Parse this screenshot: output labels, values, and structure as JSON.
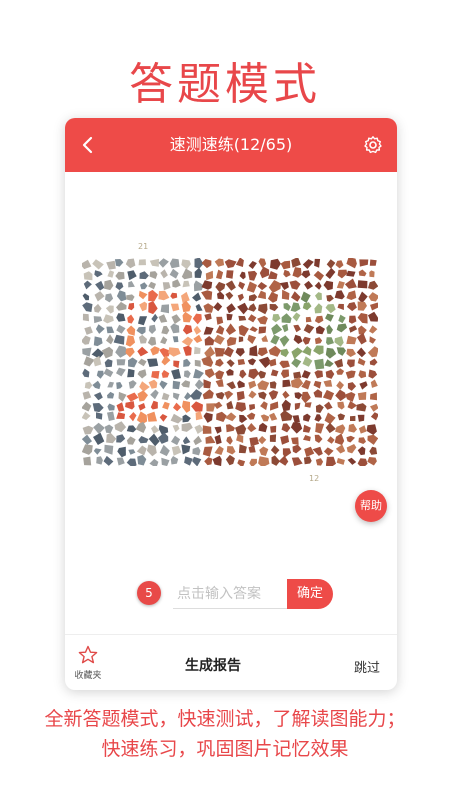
{
  "promo": {
    "title": "答题模式",
    "caption_line1": "全新答题模式，快速测试，了解读图能力；",
    "caption_line2": "快速练习，巩固图片记忆效果"
  },
  "app_bar": {
    "title": "速测速练(12/65)"
  },
  "plate": {
    "label_top": "21",
    "label_bottom": "12"
  },
  "help_button": {
    "label": "帮助"
  },
  "answer": {
    "badge": "5",
    "placeholder": "点击输入答案",
    "value": "",
    "confirm_label": "确定"
  },
  "bottom_bar": {
    "favorites_label": "收藏夹",
    "report_label": "生成报告",
    "skip_label": "跳过"
  },
  "colors": {
    "accent": "#ee4b48"
  },
  "icons": {
    "back": "chevron-left-icon",
    "settings": "gear-icon",
    "favorites": "star-icon"
  }
}
